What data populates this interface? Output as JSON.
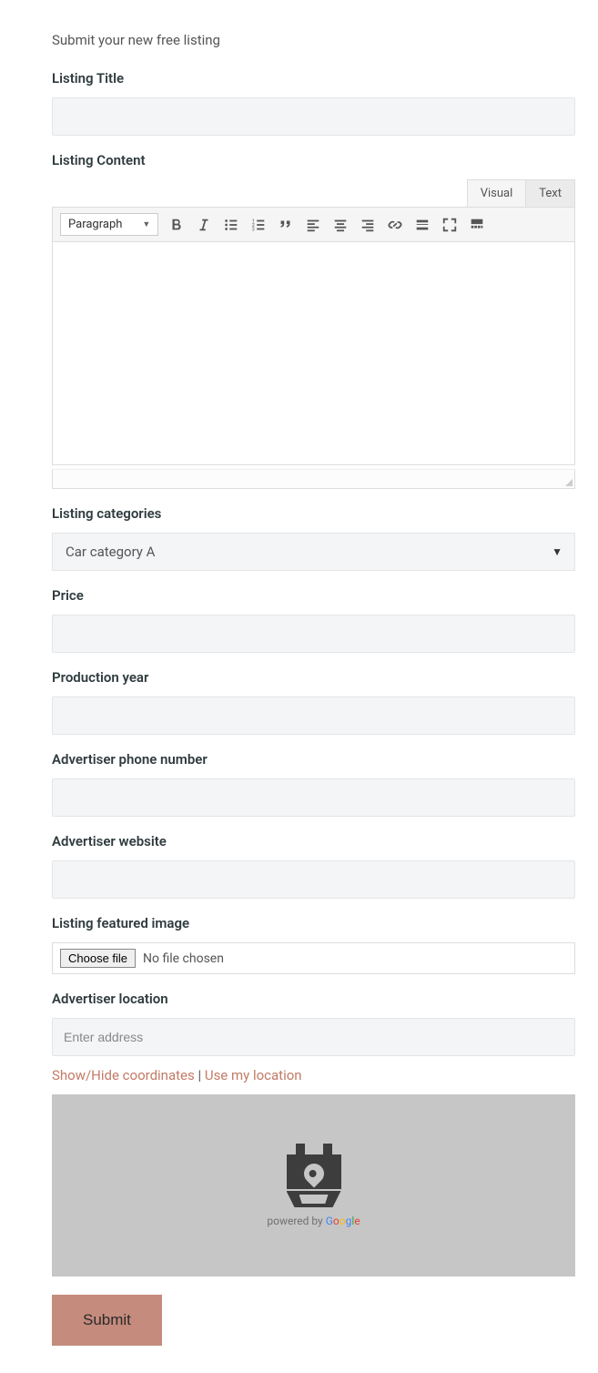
{
  "heading": "Submit your new free listing",
  "fields": {
    "title_label": "Listing Title",
    "content_label": "Listing Content",
    "categories_label": "Listing categories",
    "price_label": "Price",
    "year_label": "Production year",
    "phone_label": "Advertiser phone number",
    "website_label": "Advertiser website",
    "image_label": "Listing featured image",
    "location_label": "Advertiser location"
  },
  "editor": {
    "tabs": {
      "visual": "Visual",
      "text": "Text"
    },
    "format_select": "Paragraph"
  },
  "category_value": "Car category A",
  "file": {
    "button": "Choose file",
    "status": "No file chosen"
  },
  "location": {
    "placeholder": "Enter address",
    "toggle_coords": "Show/Hide coordinates",
    "use_location": "Use my location",
    "separator": " | ",
    "powered_by": "powered by "
  },
  "submit_label": "Submit"
}
